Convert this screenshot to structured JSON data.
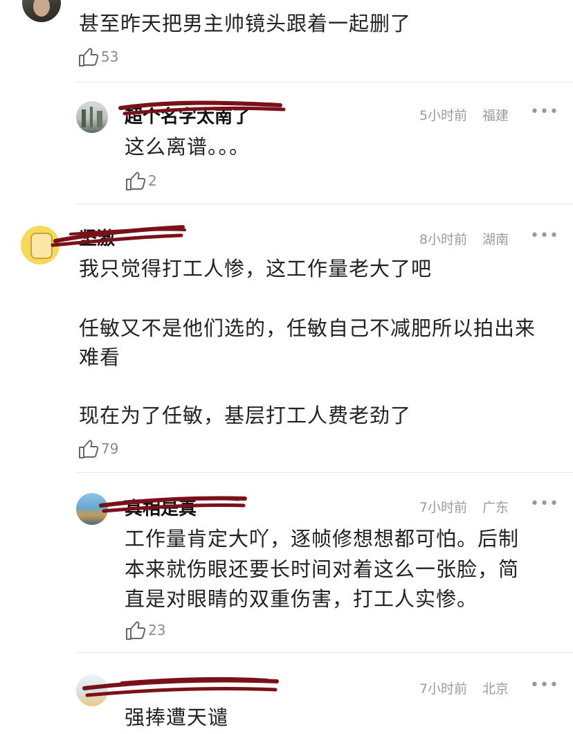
{
  "comments": [
    {
      "text": "甚至昨天把男主帅镜头跟着一起删了",
      "likes": "53"
    },
    {
      "name": "超个名字太南了",
      "time": "5小时前",
      "location": "福建",
      "text": "这么离谱。。。",
      "likes": "2"
    },
    {
      "name": "坚激",
      "time": "8小时前",
      "location": "湖南",
      "lines": [
        "我只觉得打工人惨，这工作量老大了吧",
        "任敏又不是他们选的，任敏自己不减肥所以拍出来",
        "难看",
        "现在为了任敏，基层打工人费老劲了"
      ],
      "likes": "79"
    },
    {
      "name": "真相是真",
      "time": "7小时前",
      "location": "广东",
      "lines": [
        "工作量肯定大吖，逐帧修想想都可怕。后制",
        "本来就伤眼还要长时间对着这么一张脸，简",
        "直是对眼睛的双重伤害，打工人实惨。"
      ],
      "likes": "23"
    },
    {
      "time": "7小时前",
      "location": "北京",
      "text": "强捧遭天谴"
    }
  ],
  "more_icon": "•••",
  "colors": {
    "redaction": "#7a1018",
    "meta": "#9a9a9a"
  }
}
